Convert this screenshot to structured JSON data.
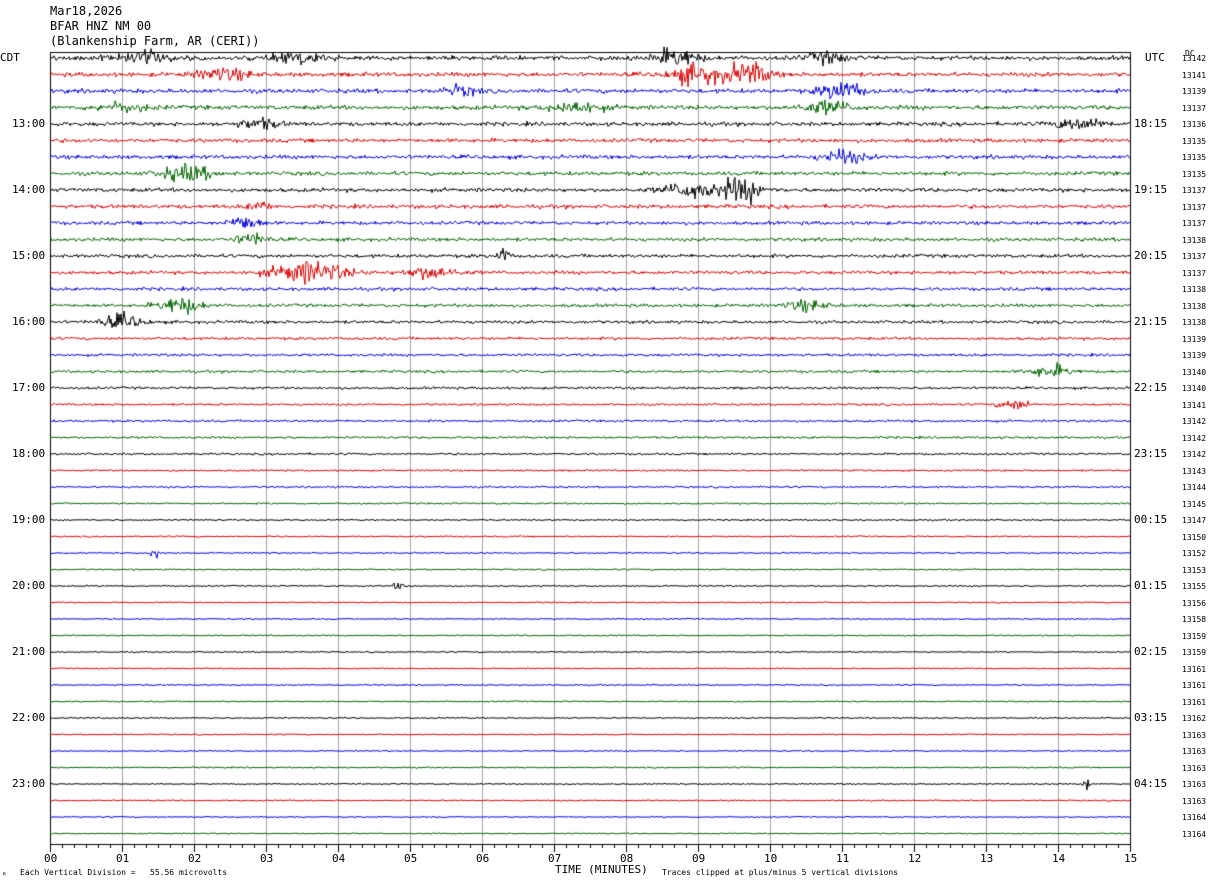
{
  "header": {
    "date": "Mar18,2026",
    "station": "BFAR HNZ NM 00",
    "location": "(Blankenship Farm, AR (CERI))"
  },
  "labels": {
    "left_tz": "CDT",
    "right_tz": "UTC",
    "dc": "DC",
    "xlabel": "TIME (MINUTES)",
    "scale_note": "Each Vertical Division =   55.56 microvolts",
    "clip_note": "Traces clipped at plus/minus 5 vertical divisions"
  },
  "colors": {
    "trace_cycle": [
      "#000000",
      "#dd0000",
      "#0000dd",
      "#006600"
    ],
    "grid": "#666666",
    "background": "#ffffff"
  },
  "chart_data": {
    "type": "line",
    "title": "BFAR HNZ NM 00",
    "xlabel": "TIME (MINUTES)",
    "xlim": [
      0,
      15
    ],
    "x_ticks": [
      "00",
      "01",
      "02",
      "03",
      "04",
      "05",
      "06",
      "07",
      "08",
      "09",
      "10",
      "11",
      "12",
      "13",
      "14",
      "15"
    ],
    "rows_per_hour": 4,
    "left_time_labels": [
      "13:00",
      "14:00",
      "15:00",
      "16:00",
      "17:00",
      "18:00",
      "19:00",
      "20:00",
      "21:00",
      "22:00",
      "23:00"
    ],
    "right_time_labels": [
      "18:15",
      "19:15",
      "20:15",
      "21:15",
      "22:15",
      "23:15",
      "00:15",
      "01:15",
      "02:15",
      "03:15",
      "04:15"
    ],
    "hour_label_rows": [
      4,
      8,
      12,
      16,
      20,
      24,
      28,
      32,
      36,
      40,
      44
    ],
    "dc_offsets": [
      "13142",
      "13141",
      "13139",
      "13137",
      "13136",
      "13135",
      "13135",
      "13135",
      "13137",
      "13137",
      "13137",
      "13138",
      "13137",
      "13137",
      "13138",
      "13138",
      "13138",
      "13139",
      "13139",
      "13140",
      "13140",
      "13141",
      "13142",
      "13142",
      "13142",
      "13143",
      "13144",
      "13145",
      "13147",
      "13150",
      "13152",
      "13153",
      "13155",
      "13156",
      "13158",
      "13159",
      "13159",
      "13161",
      "13161",
      "13161",
      "13162",
      "13163",
      "13163",
      "13163",
      "13163",
      "13163",
      "13164",
      "13164"
    ],
    "row_noise": [
      0.22,
      0.22,
      0.22,
      0.22,
      0.2,
      0.2,
      0.2,
      0.2,
      0.2,
      0.2,
      0.18,
      0.18,
      0.18,
      0.18,
      0.17,
      0.17,
      0.16,
      0.15,
      0.14,
      0.14,
      0.13,
      0.12,
      0.12,
      0.12,
      0.11,
      0.1,
      0.1,
      0.09,
      0.08,
      0.08,
      0.08,
      0.08,
      0.08,
      0.07,
      0.07,
      0.07,
      0.07,
      0.07,
      0.07,
      0.07,
      0.07,
      0.07,
      0.07,
      0.07,
      0.07,
      0.07,
      0.07,
      0.07
    ],
    "bursts": [
      {
        "row": 0,
        "minute": 1.3,
        "width": 0.6,
        "amp": 0.5
      },
      {
        "row": 0,
        "minute": 3.4,
        "width": 0.5,
        "amp": 0.45
      },
      {
        "row": 0,
        "minute": 8.7,
        "width": 0.4,
        "amp": 0.9
      },
      {
        "row": 0,
        "minute": 10.8,
        "width": 0.4,
        "amp": 0.5
      },
      {
        "row": 1,
        "minute": 2.4,
        "width": 0.5,
        "amp": 0.6
      },
      {
        "row": 1,
        "minute": 9.0,
        "width": 0.5,
        "amp": 1.0
      },
      {
        "row": 1,
        "minute": 9.7,
        "width": 0.4,
        "amp": 1.1
      },
      {
        "row": 2,
        "minute": 5.7,
        "width": 0.3,
        "amp": 0.5
      },
      {
        "row": 2,
        "minute": 11.0,
        "width": 0.4,
        "amp": 0.9
      },
      {
        "row": 3,
        "minute": 1.0,
        "width": 0.5,
        "amp": 0.45
      },
      {
        "row": 3,
        "minute": 7.3,
        "width": 0.5,
        "amp": 0.6
      },
      {
        "row": 3,
        "minute": 10.8,
        "width": 0.5,
        "amp": 0.6
      },
      {
        "row": 4,
        "minute": 2.9,
        "width": 0.4,
        "amp": 0.5
      },
      {
        "row": 4,
        "minute": 14.3,
        "width": 0.5,
        "amp": 0.6
      },
      {
        "row": 6,
        "minute": 11.0,
        "width": 0.4,
        "amp": 0.7
      },
      {
        "row": 7,
        "minute": 1.9,
        "width": 0.5,
        "amp": 0.8
      },
      {
        "row": 8,
        "minute": 8.9,
        "width": 0.5,
        "amp": 0.8
      },
      {
        "row": 8,
        "minute": 9.6,
        "width": 0.4,
        "amp": 1.2
      },
      {
        "row": 9,
        "minute": 2.9,
        "width": 0.2,
        "amp": 0.5
      },
      {
        "row": 10,
        "minute": 2.7,
        "width": 0.3,
        "amp": 0.7
      },
      {
        "row": 11,
        "minute": 2.8,
        "width": 0.3,
        "amp": 0.6
      },
      {
        "row": 12,
        "minute": 6.3,
        "width": 0.1,
        "amp": 0.9
      },
      {
        "row": 13,
        "minute": 3.6,
        "width": 0.7,
        "amp": 1.1
      },
      {
        "row": 13,
        "minute": 5.3,
        "width": 0.5,
        "amp": 0.6
      },
      {
        "row": 15,
        "minute": 1.8,
        "width": 0.4,
        "amp": 0.8
      },
      {
        "row": 15,
        "minute": 10.5,
        "width": 0.4,
        "amp": 0.5
      },
      {
        "row": 16,
        "minute": 1.0,
        "width": 0.4,
        "amp": 0.7
      },
      {
        "row": 19,
        "minute": 13.9,
        "width": 0.4,
        "amp": 0.6
      },
      {
        "row": 21,
        "minute": 13.4,
        "width": 0.3,
        "amp": 0.5
      },
      {
        "row": 30,
        "minute": 1.45,
        "width": 0.08,
        "amp": 0.8
      },
      {
        "row": 32,
        "minute": 4.85,
        "width": 0.1,
        "amp": 0.5
      },
      {
        "row": 44,
        "minute": 14.4,
        "width": 0.05,
        "amp": 1.0
      }
    ]
  }
}
